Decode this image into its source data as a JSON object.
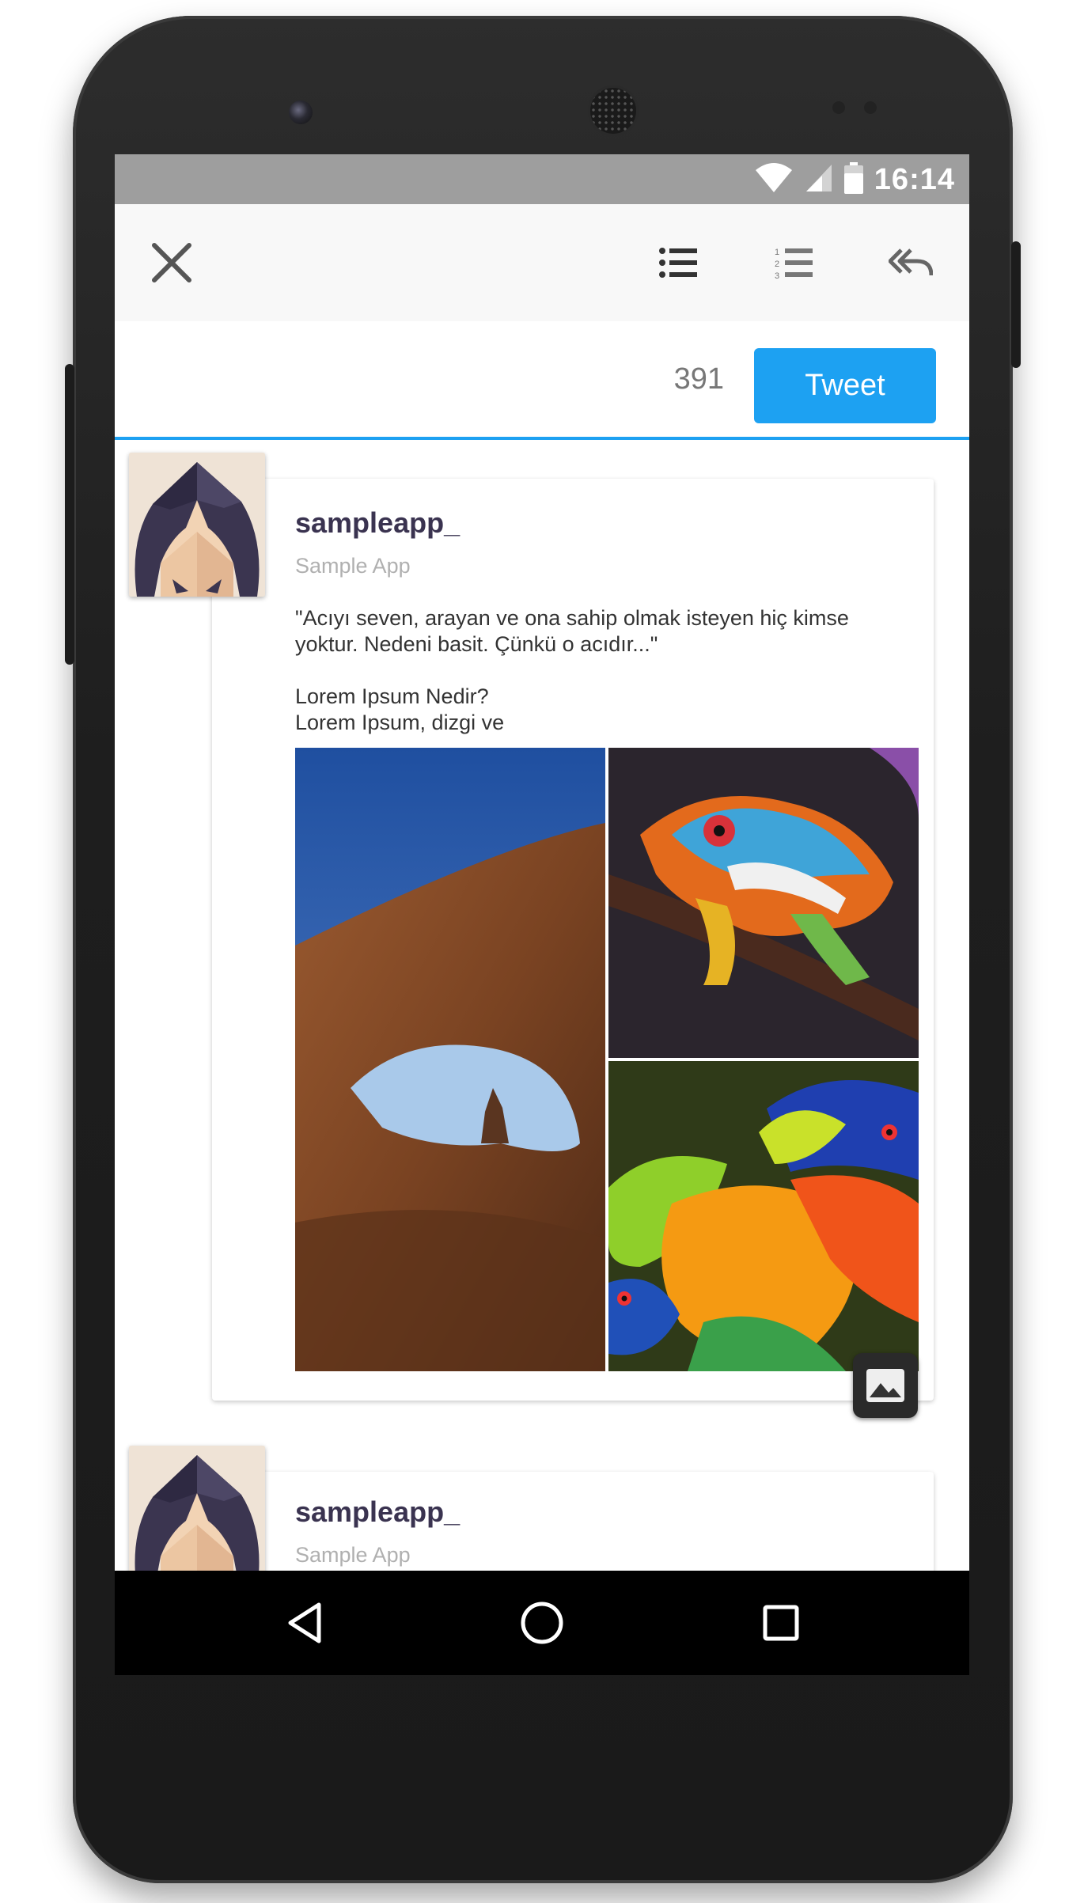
{
  "status": {
    "time": "16:14",
    "icons": [
      "wifi-icon",
      "signal-icon",
      "battery-icon"
    ]
  },
  "toolbar": {
    "icons": [
      "close-icon",
      "list-icon",
      "numbered-list-icon",
      "reply-all-icon"
    ]
  },
  "composer": {
    "char_count": "391",
    "tweet_label": "Tweet"
  },
  "colors": {
    "accent": "#1da1f2",
    "username": "#3a3350",
    "statusbar": "#9e9e9e"
  },
  "feed": {
    "tweets": [
      {
        "username": "sampleapp_",
        "fullname": "Sample App",
        "text": "\"Acıyı seven, arayan ve ona sahip olmak isteyen hiç kimse yoktur. Nedeni basit. Çünkü o acıdır...\"\n\nLorem Ipsum Nedir?\nLorem Ipsum, dizgi ve"
      },
      {
        "username": "sampleapp_",
        "fullname": "Sample App",
        "text": ""
      }
    ]
  },
  "navigation": {
    "icons": [
      "back-icon",
      "home-icon",
      "recents-icon"
    ]
  }
}
